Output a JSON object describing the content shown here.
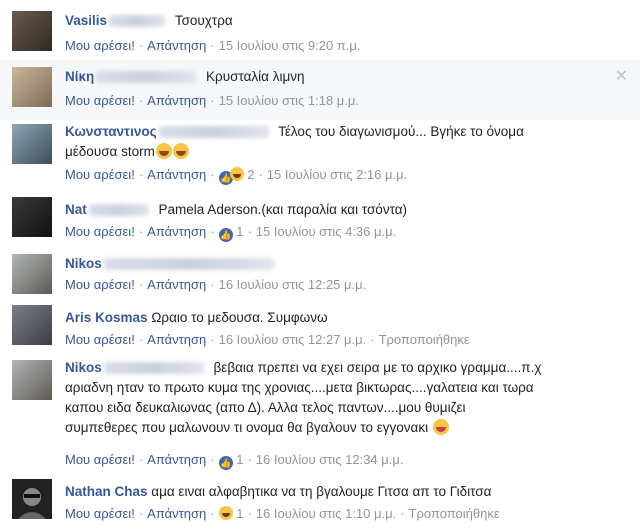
{
  "labels": {
    "like": "Μου αρέσει!",
    "reply": "Απάντηση",
    "edited": "Τροποποιήθηκε",
    "close": "✕"
  },
  "comments": [
    {
      "name": "Vasilis",
      "text": "Τσουχτρα",
      "time": "15 Ιουλίου στις 9:20 π.μ."
    },
    {
      "name": "Νίκη",
      "text": "Κρυσταλία λιμνη",
      "time": "15 Ιουλίου στις 1:18 μ.μ."
    },
    {
      "name": "Κωνσταντινος",
      "text1": "Τέλος του διαγωνισμού... Βγήκε το όνομα",
      "text2": "μέδουσα storm",
      "reactions": "2",
      "time": "15 Ιουλίου στις 2:16 μ.μ."
    },
    {
      "name": "Nat",
      "text": "Pamela Aderson.(και παραλία και τσόντα)",
      "reactions": "1",
      "time": "15 Ιουλίου στις 4:36 μ.μ."
    },
    {
      "name": "Nikos",
      "text": "",
      "time": "16 Ιουλίου στις 12:25 μ.μ."
    },
    {
      "name": "Aris Kosmas",
      "text": "Ωραιο το μεδουσα. Συμφωνω",
      "time": "16 Ιουλίου στις 12:27 μ.μ."
    },
    {
      "name": "Nikos",
      "text1": "βεβαια πρεπει να εχει σειρα με το αρχικο γραμμα....π.χ",
      "text2": "αριαδνη ηταν το πρωτο κυμα της χρονιας....μετα βικτωρας....γαλατεια και τωρα",
      "text3": "καπου ειδα δευκαλιωνας (απο Δ). Αλλα τελος παντων....μου θυμιζει",
      "text4": "συμπεθερες που μαλωνουν τι ονομα θα βγαλουν το εγγονακι",
      "reactions": "1",
      "time": "16 Ιουλίου στις 12:34 μ.μ."
    },
    {
      "name": "Nathan Chas",
      "text": "αμα ειναι αλφαβητικα να τη βγαλουμε Γιτσα απ το Γιδιτσα",
      "reactions": "1",
      "time": "16 Ιουλίου στις 1:10 μ.μ."
    }
  ]
}
